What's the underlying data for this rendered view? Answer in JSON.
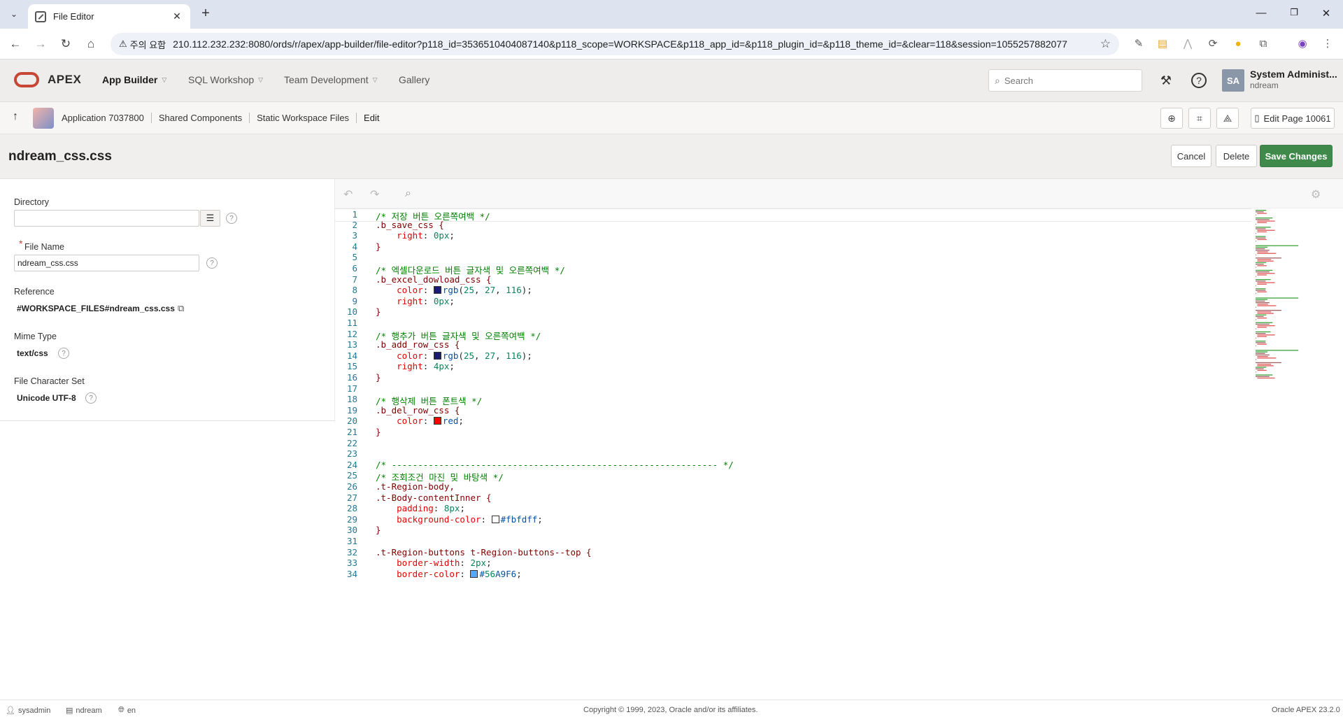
{
  "browser": {
    "tab_title": "File Editor",
    "security_label": "주의 요함",
    "url": "210.112.232.232:8080/ords/r/apex/app-builder/file-editor?p118_id=3536510404087140&p118_scope=WORKSPACE&p118_app_id=&p118_plugin_id=&p118_theme_id=&clear=118&session=1055257882077"
  },
  "apex_header": {
    "logo": "APEX",
    "menus": [
      "App Builder",
      "SQL Workshop",
      "Team Development",
      "Gallery"
    ],
    "search_placeholder": "Search",
    "avatar_initials": "SA",
    "user_name": "System Administ...",
    "workspace": "ndream"
  },
  "breadcrumb": {
    "items": [
      "Application 7037800",
      "Shared Components",
      "Static Workspace Files",
      "Edit"
    ],
    "edit_page_label": "Edit Page 10061"
  },
  "page": {
    "title": "ndream_css.css",
    "cancel_label": "Cancel",
    "delete_label": "Delete",
    "save_label": "Save Changes"
  },
  "form": {
    "directory_label": "Directory",
    "directory_value": "",
    "file_name_label": "File Name",
    "file_name_value": "ndream_css.css",
    "reference_label": "Reference",
    "reference_value": "#WORKSPACE_FILES#ndream_css.css",
    "mime_type_label": "Mime Type",
    "mime_type_value": "text/css",
    "charset_label": "File Character Set",
    "charset_value": "Unicode UTF-8"
  },
  "code_lines": [
    "/* 저장 버튼 오른쪽여백 */",
    ".b_save_css {",
    "    right: 0px;",
    "}",
    "",
    "/* 엑셀다운로드 버튼 글자색 및 오른쪽여백 */",
    ".b_excel_dowload_css {",
    "    color: rgb(25, 27, 116);",
    "    right: 0px;",
    "}",
    "",
    "/* 행추가 버튼 글자색 및 오른쪽여백 */",
    ".b_add_row_css {",
    "    color: rgb(25, 27, 116);",
    "    right: 4px;",
    "}",
    "",
    "/* 행삭제 버튼 폰트색 */",
    ".b_del_row_css {",
    "    color: red;",
    "}",
    "",
    "",
    "/* -------------------------------------------------------------- */",
    "/* 조회조건 마진 및 바탕색 */",
    ".t-Region-body,",
    ".t-Body-contentInner {",
    "    padding: 8px;",
    "    background-color: #fbfdff;",
    "}",
    "",
    ".t-Region-buttons t-Region-buttons--top {",
    "    border-width: 2px;",
    "    border-color: #56A9F6;"
  ],
  "colors": {
    "accent_red": "#c74634",
    "save_green": "#3f8a4b"
  },
  "footer": {
    "user": "sysadmin",
    "workspace": "ndream",
    "language": "en",
    "copyright": "Copyright © 1999, 2023, Oracle and/or its affiliates.",
    "version": "Oracle APEX 23.2.0"
  }
}
